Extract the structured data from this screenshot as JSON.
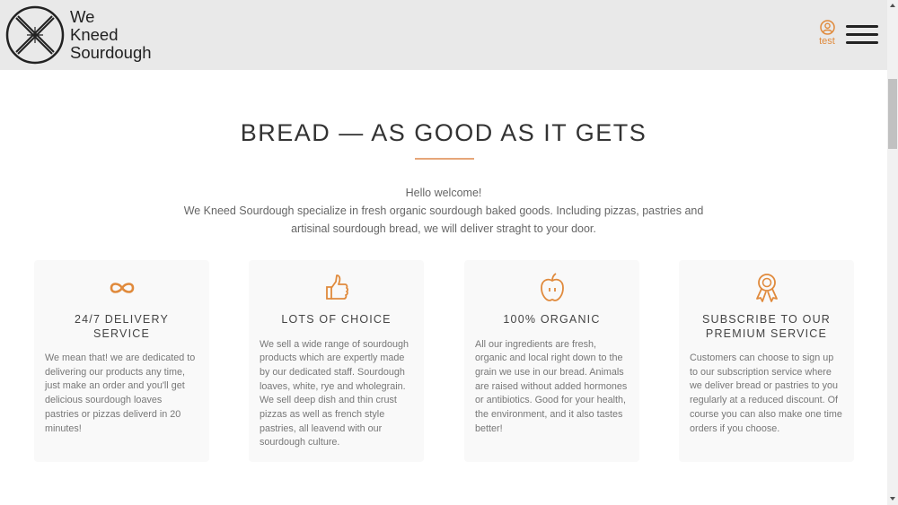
{
  "brand": {
    "line1": "We",
    "line2": "Kneed",
    "line3": "Sourdough"
  },
  "header": {
    "account_label": "test"
  },
  "hero": {
    "title": "BREAD — AS GOOD AS IT GETS",
    "greeting": "Hello welcome!",
    "description": "We Kneed Sourdough specialize in fresh organic sourdough baked goods. Including pizzas, pastries and artisinal sourdough bread, we will deliver straght to your door."
  },
  "features": [
    {
      "icon": "infinity-icon",
      "title": "24/7 DELIVERY SERVICE",
      "text": "We mean that! we are dedicated to delivering our products any time, just make an order and you'll get delicious sourdough loaves pastries or pizzas deliverd in 20 minutes!"
    },
    {
      "icon": "thumbs-up-icon",
      "title": "LOTS OF CHOICE",
      "text": "We sell a wide range of sourdough products which are expertly made by our dedicated staff. Sourdough loaves, white, rye and wholegrain. We sell deep dish and thin crust pizzas as well as french style pastries, all leavend with our sourdough culture."
    },
    {
      "icon": "apple-icon",
      "title": "100% ORGANIC",
      "text": "All our ingredients are fresh, organic and local right down to the grain we use in our bread. Animals are raised without added hormones or antibiotics. Good for your health, the environment, and it also tastes better!"
    },
    {
      "icon": "award-ribbon-icon",
      "title": "SUBSCRIBE TO OUR PREMIUM SERVICE",
      "text": "Customers can choose to sign up to our subscription service where we deliver bread or pastries to you regularly at a reduced discount. Of course you can also make one time orders if you choose."
    }
  ],
  "colors": {
    "accent": "#e08a3c",
    "header_bg": "#e9e9e9",
    "card_bg": "#f9f9f9"
  }
}
